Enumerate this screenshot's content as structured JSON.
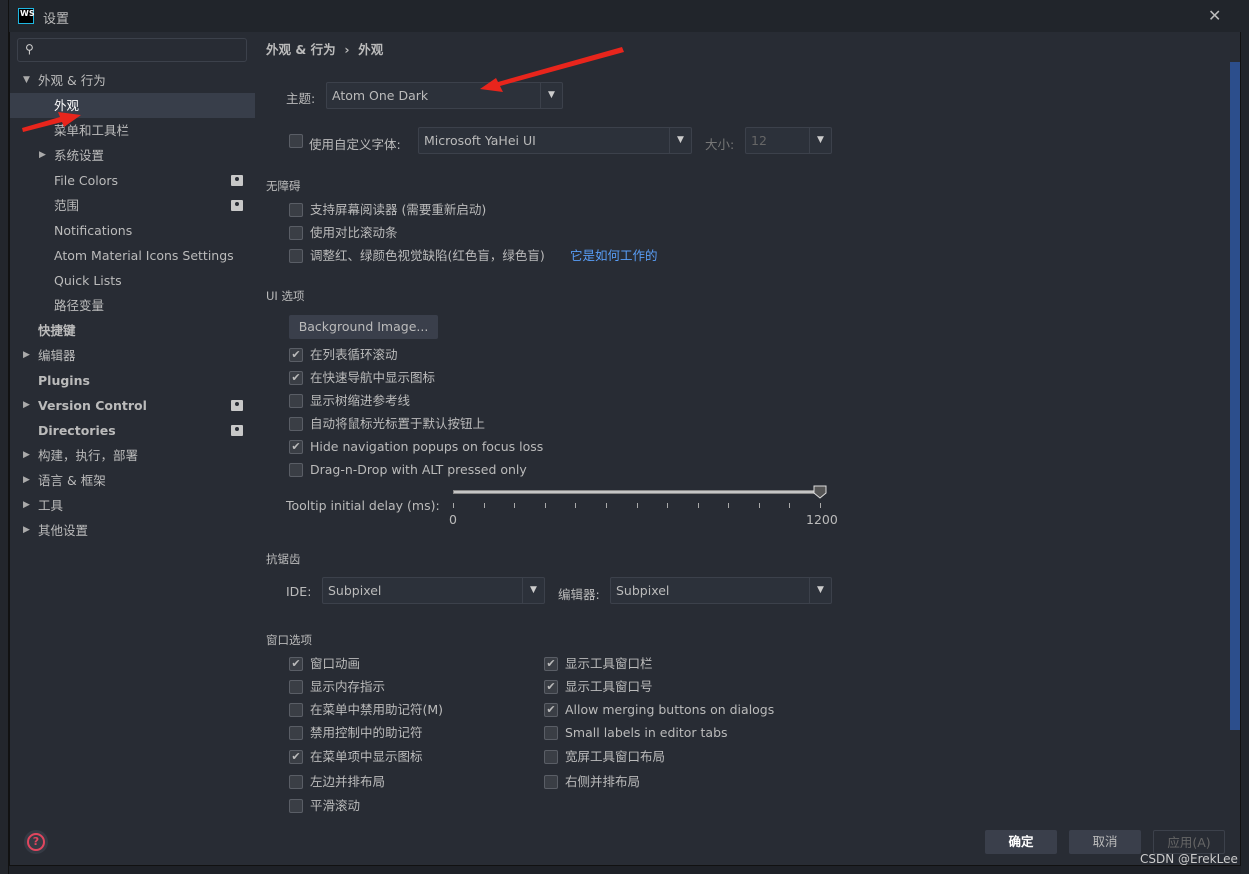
{
  "window": {
    "title": "设置",
    "logo": "WS",
    "close_icon": "close-icon"
  },
  "search": {
    "placeholder": "",
    "icon": "search-icon"
  },
  "sidebar": {
    "items": [
      {
        "label": "外观 & 行为",
        "expanded": true,
        "bold": false
      },
      {
        "label": "外观",
        "selected": true
      },
      {
        "label": "菜单和工具栏"
      },
      {
        "label": "系统设置",
        "expandable": true
      },
      {
        "label": "File Colors",
        "badge": true
      },
      {
        "label": "范围",
        "badge": true
      },
      {
        "label": "Notifications"
      },
      {
        "label": "Atom Material Icons Settings"
      },
      {
        "label": "Quick Lists"
      },
      {
        "label": "路径变量"
      },
      {
        "label": "快捷键",
        "bold": true
      },
      {
        "label": "编辑器",
        "expandable": true
      },
      {
        "label": "Plugins",
        "bold": true
      },
      {
        "label": "Version Control",
        "expandable": true,
        "bold": true,
        "badge": true
      },
      {
        "label": "Directories",
        "bold": true,
        "badge": true
      },
      {
        "label": "构建，执行，部署",
        "expandable": true
      },
      {
        "label": "语言 & 框架",
        "expandable": true
      },
      {
        "label": "工具",
        "expandable": true
      },
      {
        "label": "其他设置",
        "expandable": true
      }
    ]
  },
  "breadcrumb": {
    "parent": "外观 & 行为",
    "sep": "›",
    "current": "外观"
  },
  "theme": {
    "label": "主题:",
    "value": "Atom One Dark"
  },
  "font": {
    "checkbox_label": "使用自定义字体:",
    "checked": false,
    "value": "Microsoft YaHei UI",
    "size_label": "大小:",
    "size": "12"
  },
  "accessibility": {
    "title": "无障碍",
    "items": [
      {
        "label": "支持屏幕阅读器 (需要重新启动)",
        "checked": false
      },
      {
        "label": "使用对比滚动条",
        "checked": false
      },
      {
        "label": "调整红、绿颜色视觉缺陷(红色盲，绿色盲)",
        "checked": false,
        "link": "它是如何工作的"
      }
    ]
  },
  "ui": {
    "title": "UI 选项",
    "bg_button": "Background Image...",
    "items": [
      {
        "label": "在列表循环滚动",
        "checked": true
      },
      {
        "label": "在快速导航中显示图标",
        "checked": true
      },
      {
        "label": "显示树缩进参考线",
        "checked": false
      },
      {
        "label": "自动将鼠标光标置于默认按钮上",
        "checked": false
      },
      {
        "label": "Hide navigation popups on focus loss",
        "checked": true
      },
      {
        "label": "Drag-n-Drop with ALT pressed only",
        "checked": false
      }
    ],
    "tooltip": {
      "label": "Tooltip initial delay (ms):",
      "min": "0",
      "max": "1200",
      "value": 1200
    }
  },
  "antialias": {
    "title": "抗锯齿",
    "ide_label": "IDE:",
    "ide_value": "Subpixel",
    "editor_label": "编辑器:",
    "editor_value": "Subpixel"
  },
  "window_opts": {
    "title": "窗口选项",
    "left": [
      {
        "label": "窗口动画",
        "checked": true
      },
      {
        "label": "显示内存指示",
        "checked": false
      },
      {
        "label": "在菜单中禁用助记符(M)",
        "checked": false
      },
      {
        "label": "禁用控制中的助记符",
        "checked": false
      },
      {
        "label": "在菜单项中显示图标",
        "checked": true
      },
      {
        "label": "左边并排布局",
        "checked": false
      },
      {
        "label": "平滑滚动",
        "checked": false
      }
    ],
    "right": [
      {
        "label": "显示工具窗口栏",
        "checked": true
      },
      {
        "label": "显示工具窗口号",
        "checked": true
      },
      {
        "label": "Allow merging buttons on dialogs",
        "checked": true
      },
      {
        "label": "Small labels in editor tabs",
        "checked": false
      },
      {
        "label": "宽屏工具窗口布局",
        "checked": false
      },
      {
        "label": "右侧并排布局",
        "checked": false
      }
    ]
  },
  "buttons": {
    "ok": "确定",
    "cancel": "取消",
    "apply": "应用(A)"
  },
  "watermark": "CSDN @ErekLee",
  "colors": {
    "background": "#282c34",
    "titlebar": "#21252b",
    "selection": "#383e4a",
    "link": "#589df6",
    "annotation_arrow": "#e8251c"
  }
}
